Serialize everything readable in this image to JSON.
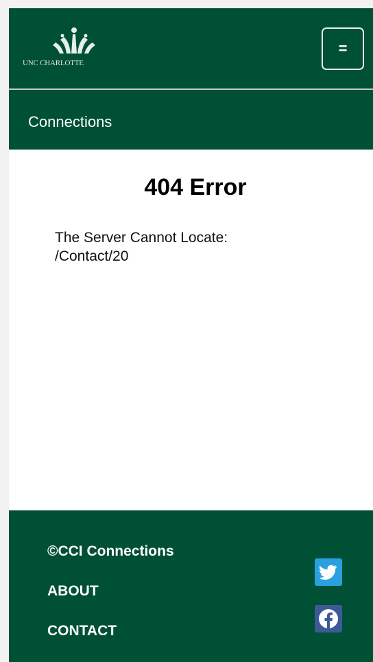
{
  "header": {
    "logo_text": "UNC CHARLOTTE",
    "menu_label": "="
  },
  "nav": {
    "site_title": "Connections"
  },
  "main": {
    "error_title": "404 Error",
    "message_line1": "The Server Cannot Locate:",
    "message_line2": "/Contact/20"
  },
  "footer": {
    "copyright": "©CCI Connections",
    "about_label": "ABOUT",
    "contact_label": "CONTACT",
    "social": [
      "twitter-icon",
      "facebook-icon"
    ]
  },
  "colors": {
    "brand_green": "#005035",
    "twitter_blue": "#2aa0e0",
    "facebook_blue": "#3d5a98"
  }
}
